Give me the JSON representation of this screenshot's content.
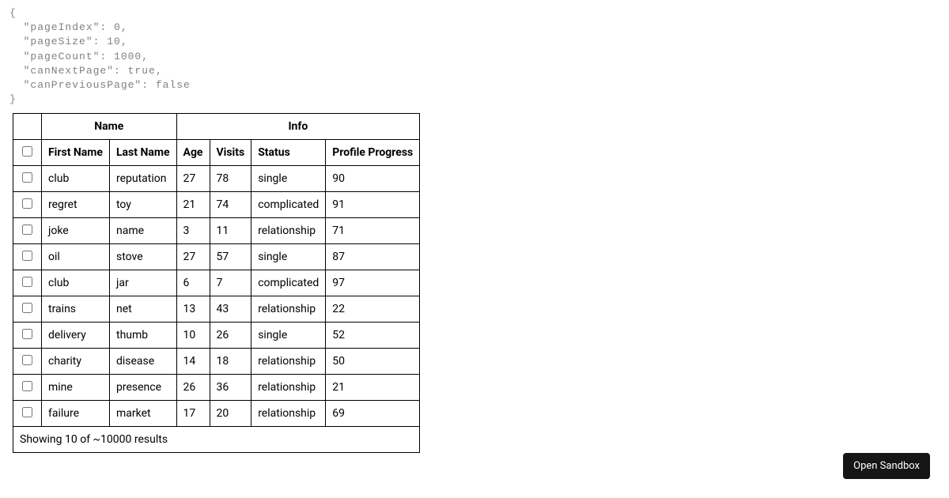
{
  "debug": {
    "pageIndex": 0,
    "pageSize": 10,
    "pageCount": 1000,
    "canNextPage": true,
    "canPreviousPage": false
  },
  "headers": {
    "group_name": "Name",
    "group_info": "Info",
    "first_name": "First Name",
    "last_name": "Last Name",
    "age": "Age",
    "visits": "Visits",
    "status": "Status",
    "profile_progress": "Profile Progress"
  },
  "rows": [
    {
      "first_name": "club",
      "last_name": "reputation",
      "age": "27",
      "visits": "78",
      "status": "single",
      "profile_progress": "90"
    },
    {
      "first_name": "regret",
      "last_name": "toy",
      "age": "21",
      "visits": "74",
      "status": "complicated",
      "profile_progress": "91"
    },
    {
      "first_name": "joke",
      "last_name": "name",
      "age": "3",
      "visits": "11",
      "status": "relationship",
      "profile_progress": "71"
    },
    {
      "first_name": "oil",
      "last_name": "stove",
      "age": "27",
      "visits": "57",
      "status": "single",
      "profile_progress": "87"
    },
    {
      "first_name": "club",
      "last_name": "jar",
      "age": "6",
      "visits": "7",
      "status": "complicated",
      "profile_progress": "97"
    },
    {
      "first_name": "trains",
      "last_name": "net",
      "age": "13",
      "visits": "43",
      "status": "relationship",
      "profile_progress": "22"
    },
    {
      "first_name": "delivery",
      "last_name": "thumb",
      "age": "10",
      "visits": "26",
      "status": "single",
      "profile_progress": "52"
    },
    {
      "first_name": "charity",
      "last_name": "disease",
      "age": "14",
      "visits": "18",
      "status": "relationship",
      "profile_progress": "50"
    },
    {
      "first_name": "mine",
      "last_name": "presence",
      "age": "26",
      "visits": "36",
      "status": "relationship",
      "profile_progress": "21"
    },
    {
      "first_name": "failure",
      "last_name": "market",
      "age": "17",
      "visits": "20",
      "status": "relationship",
      "profile_progress": "69"
    }
  ],
  "results_text": "Showing 10 of ~10000 results",
  "open_sandbox_label": "Open Sandbox"
}
